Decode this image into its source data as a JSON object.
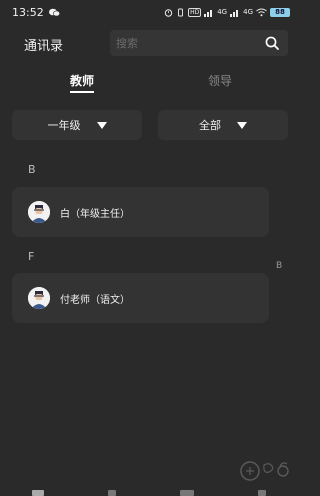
{
  "status_bar": {
    "time": "13:52",
    "net_badge_1": "4G",
    "net_badge_2": "4G",
    "battery": "88"
  },
  "header": {
    "title": "通讯录",
    "search_placeholder": "搜索"
  },
  "tabs": [
    {
      "label": "教师",
      "active": true
    },
    {
      "label": "领导",
      "active": false
    }
  ],
  "filters": {
    "grade": "一年级",
    "scope": "全部"
  },
  "sections": [
    {
      "letter": "B",
      "contacts": [
        {
          "name": "白（年级主任）"
        }
      ]
    },
    {
      "letter": "F",
      "contacts": [
        {
          "name": "付老师（语文）"
        }
      ]
    }
  ],
  "side_index": [
    "B"
  ],
  "colors": {
    "background": "#2a2a2a",
    "card": "#333333",
    "accent_text": "#ffffff",
    "muted_text": "#8a8a8a"
  }
}
